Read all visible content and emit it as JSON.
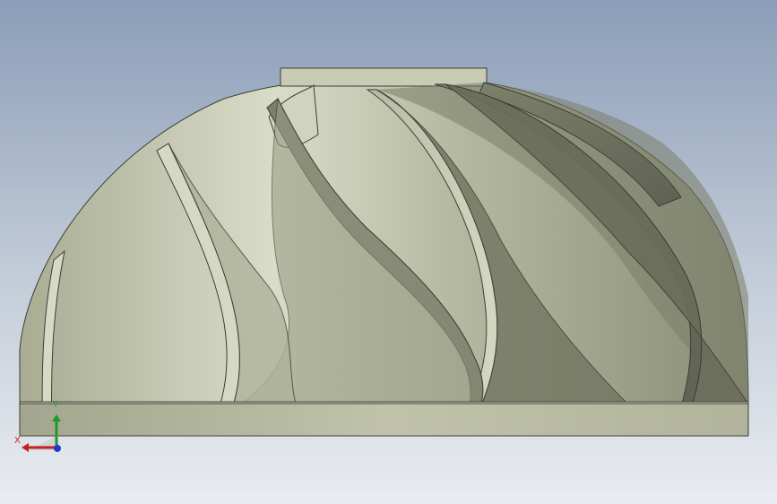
{
  "viewport": {
    "background_top": "#8b9db8",
    "background_bottom": "#e9ecf1"
  },
  "model": {
    "part": "impeller",
    "blade_count": 8,
    "color": "#c4c7aa"
  },
  "triad": {
    "x_label": "X",
    "y_label": "Y",
    "x_color": "#c81e1e",
    "y_color": "#1e9a2d",
    "z_color": "#1e3cc8"
  }
}
